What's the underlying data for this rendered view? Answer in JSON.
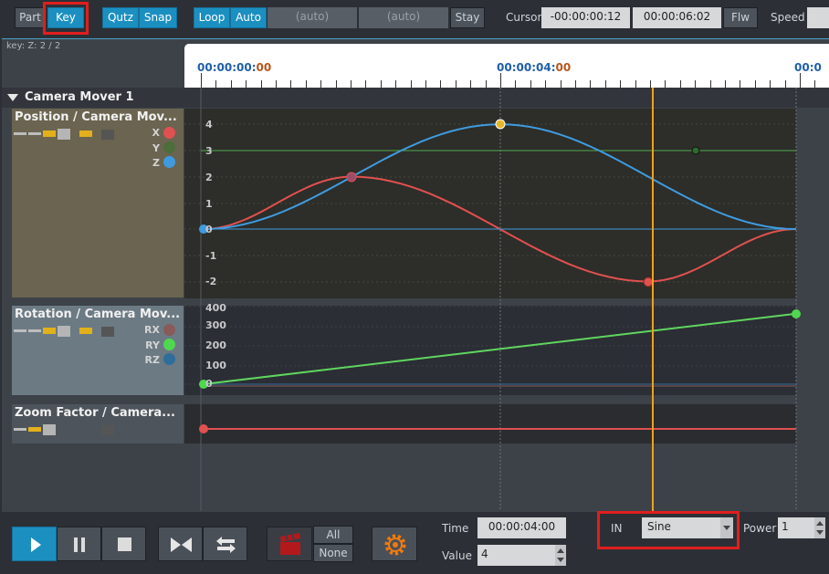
{
  "toolbar": {
    "part": "Part",
    "key": "Key",
    "qutz": "Qutz",
    "snap": "Snap",
    "loop": "Loop",
    "auto": "Auto",
    "auto_field_1": "(auto)",
    "auto_field_2": "(auto)",
    "stay": "Stay",
    "cursor_label": "Cursor",
    "cursor_value": "-00:00:00:12",
    "cursor_end": "00:00:06:02",
    "flw": "Flw",
    "speed_label": "Speed"
  },
  "key_info": "key: Z: 2 / 2",
  "ruler": {
    "t0_main": "00:00:00:",
    "t0_frames": "00",
    "t4_main": "00:00:04:",
    "t4_frames": "00",
    "t8_partial": "00:0"
  },
  "group": {
    "name": "Camera Mover 1"
  },
  "tracks": {
    "position": {
      "title": "Position  /  Camera Mov...",
      "channels": [
        "X",
        "Y",
        "Z"
      ],
      "y_ticks": [
        "4",
        "3",
        "2",
        "1",
        "0",
        "-1",
        "-2"
      ]
    },
    "rotation": {
      "title": "Rotation  /  Camera Mov...",
      "channels": [
        "RX",
        "RY",
        "RZ"
      ],
      "y_ticks": [
        "400",
        "300",
        "200",
        "100",
        "0"
      ]
    },
    "zoom": {
      "title": "Zoom Factor  /  Camera..."
    }
  },
  "colors": {
    "x": "#e0514f",
    "y": "#4fb04f",
    "z": "#3f9be0",
    "rz": "#2f6d9a",
    "accent": "#1c8fc1",
    "cursor_line": "#f0a020",
    "highlight": "#e01e1e"
  },
  "bottom": {
    "all": "All",
    "none": "None",
    "time_label": "Time",
    "time_value": "00:00:04:00",
    "value_label": "Value",
    "value_value": "4",
    "in_label": "IN",
    "easing": "Sine",
    "power_label": "Power",
    "power_value": "1"
  },
  "icons": {
    "play": "play-icon",
    "pause": "pause-icon",
    "stop": "stop-icon",
    "bowtie": "bowtie-icon",
    "swap": "swap-arrows-icon",
    "clapper": "clapperboard-icon",
    "gear": "gear-icon"
  }
}
